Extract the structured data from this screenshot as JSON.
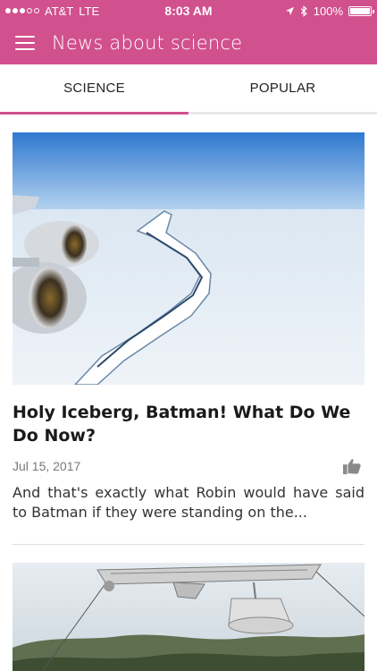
{
  "status_bar": {
    "carrier": "AT&T",
    "network": "LTE",
    "time": "8:03 AM",
    "battery_percent": "100%",
    "battery_level": 1.0,
    "icons": [
      "signal-dots-icon",
      "location-arrow-icon",
      "bluetooth-icon",
      "battery-icon"
    ]
  },
  "app_bar": {
    "title": "News about science",
    "menu_icon": "hamburger-menu-icon"
  },
  "tabs": [
    {
      "label": "SCIENCE",
      "active": true
    },
    {
      "label": "POPULAR",
      "active": false
    }
  ],
  "articles": [
    {
      "title": "Holy Iceberg, Batman! What Do We Do Now?",
      "date": "Jul 15, 2017",
      "excerpt": "And that's exactly what Robin would have said to Batman if they were standing on the...",
      "image": "iceberg-crack-from-airplane",
      "like_icon": "thumbs-up-icon"
    },
    {
      "image": "radio-telescope-over-forest"
    }
  ],
  "colors": {
    "primary": "#d1508e",
    "tab_indicator": "#d1508e",
    "divider": "#dedede"
  }
}
